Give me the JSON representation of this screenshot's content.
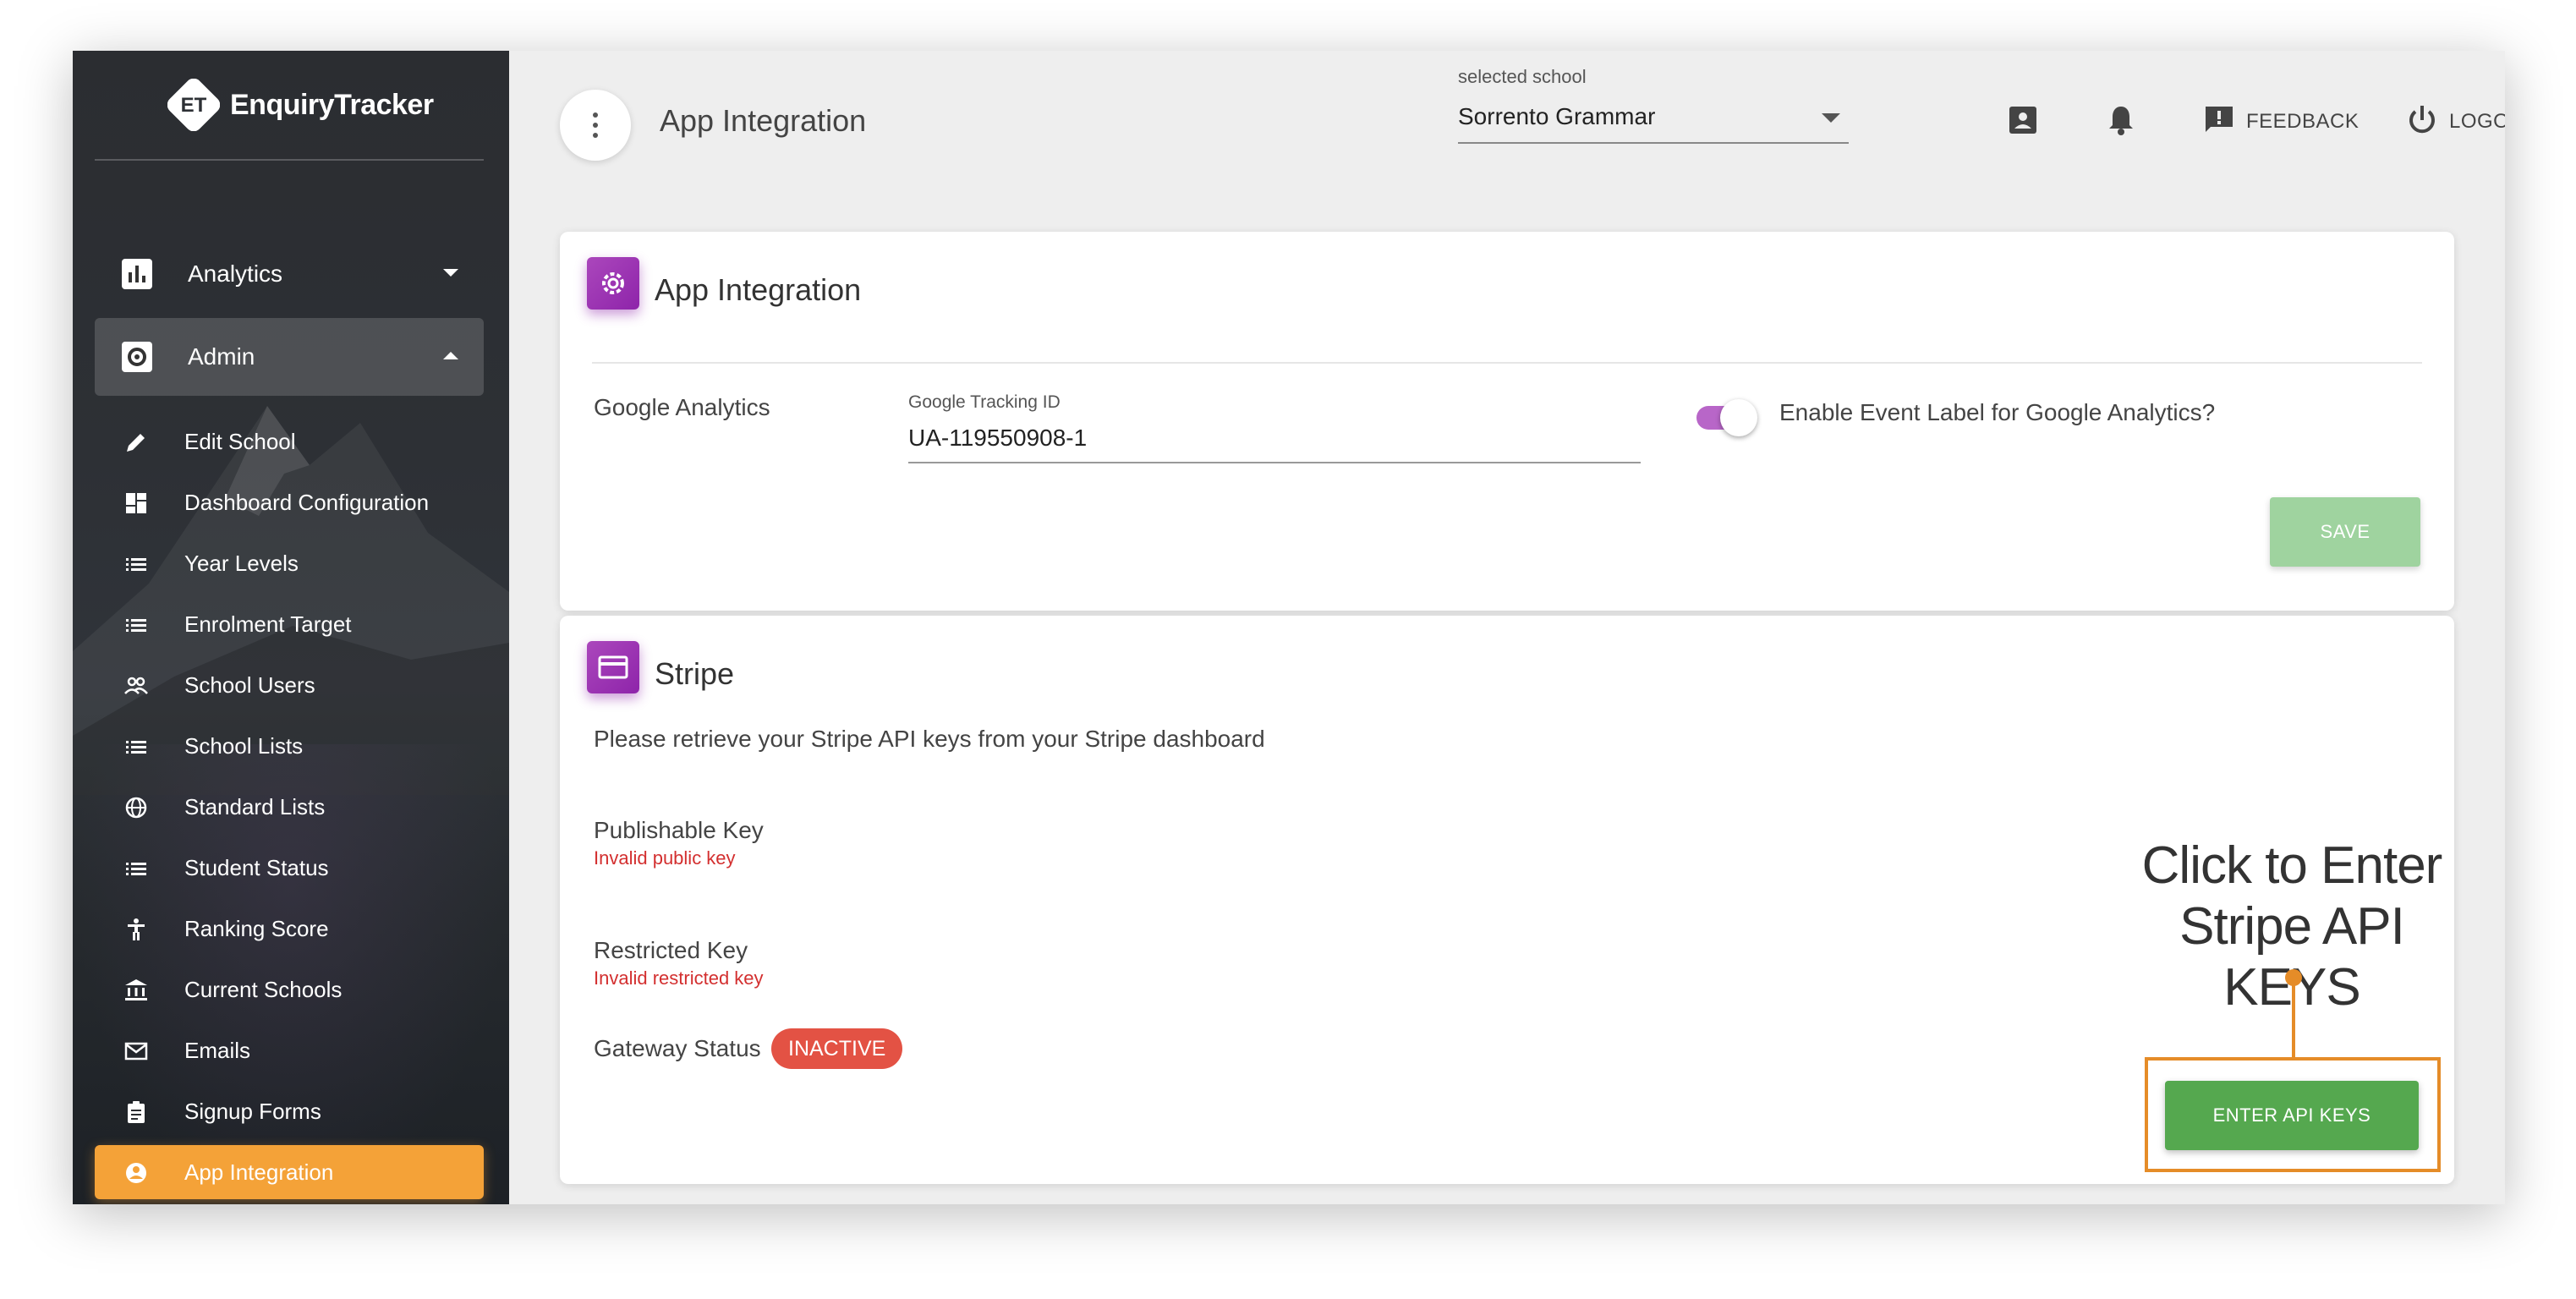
{
  "brand": {
    "name": "EnquiryTracker",
    "logo_letters": "ET"
  },
  "sidebar": {
    "main": [
      {
        "label": "Analytics",
        "icon": "bar-chart-icon",
        "expanded": false
      },
      {
        "label": "Admin",
        "icon": "settings-box-icon",
        "expanded": true
      }
    ],
    "items": [
      {
        "label": "Edit School",
        "icon": "pencil-icon"
      },
      {
        "label": "Dashboard Configuration",
        "icon": "dashboard-icon"
      },
      {
        "label": "Year Levels",
        "icon": "list-icon"
      },
      {
        "label": "Enrolment Target",
        "icon": "list-icon"
      },
      {
        "label": "School Users",
        "icon": "people-icon"
      },
      {
        "label": "School Lists",
        "icon": "list-icon"
      },
      {
        "label": "Standard Lists",
        "icon": "globe-icon"
      },
      {
        "label": "Student Status",
        "icon": "list-icon"
      },
      {
        "label": "Ranking Score",
        "icon": "accessibility-icon"
      },
      {
        "label": "Current Schools",
        "icon": "bank-icon"
      },
      {
        "label": "Emails",
        "icon": "mail-icon"
      },
      {
        "label": "Signup Forms",
        "icon": "clipboard-icon"
      },
      {
        "label": "App Integration",
        "icon": "account-circle-icon",
        "active": true
      }
    ]
  },
  "header": {
    "title": "App Integration",
    "school_label": "selected school",
    "school_value": "Sorrento Grammar",
    "feedback": "FEEDBACK",
    "logout": "LOGOUT"
  },
  "integration_card": {
    "title": "App Integration",
    "row_label": "Google Analytics",
    "field_label": "Google Tracking ID",
    "field_value": "UA-119550908-1",
    "toggle_label": "Enable Event Label for Google Analytics?",
    "toggle_on": true,
    "save": "SAVE"
  },
  "stripe_card": {
    "title": "Stripe",
    "intro": "Please retrieve your Stripe API keys from your Stripe dashboard",
    "publishable_label": "Publishable Key",
    "publishable_error": "Invalid public key",
    "restricted_label": "Restricted Key",
    "restricted_error": "Invalid restricted key",
    "gateway_label": "Gateway Status",
    "gateway_status": "INACTIVE",
    "enter_keys": "ENTER API KEYS"
  },
  "annotation": {
    "line1": "Click to Enter",
    "line2": "Stripe API KEYS"
  },
  "colors": {
    "accent_orange": "#f4a238",
    "purple": "#9c27b0",
    "green": "#55a84f",
    "red": "#e35244",
    "annotation": "#e58c28"
  }
}
